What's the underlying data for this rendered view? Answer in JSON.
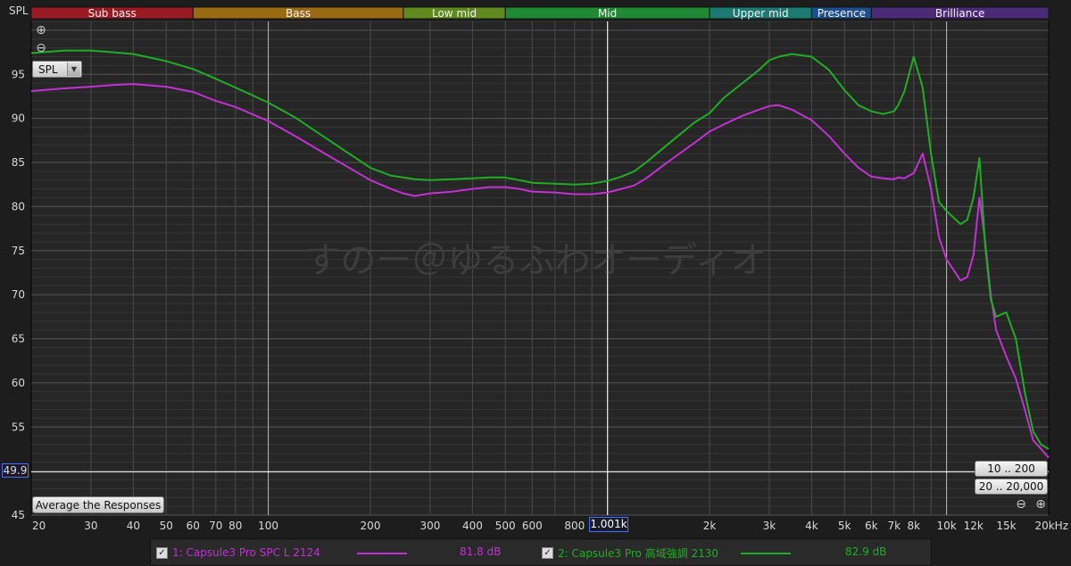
{
  "bands": [
    {
      "label": "Sub bass",
      "from": 20,
      "to": 60,
      "color": "#9b1b24"
    },
    {
      "label": "Bass",
      "from": 60,
      "to": 250,
      "color": "#9a6b12"
    },
    {
      "label": "Low mid",
      "from": 250,
      "to": 500,
      "color": "#5e8a1e"
    },
    {
      "label": "Mid",
      "from": 500,
      "to": 2000,
      "color": "#1f8a33"
    },
    {
      "label": "Upper mid",
      "from": 2000,
      "to": 4000,
      "color": "#1b7a72"
    },
    {
      "label": "Presence",
      "from": 4000,
      "to": 6000,
      "color": "#1f4e8c"
    },
    {
      "label": "Brilliance",
      "from": 6000,
      "to": 20000,
      "color": "#4b2a78"
    }
  ],
  "watermark": "すのー＠ゆるふわオーディオ",
  "controls": {
    "spl_select": "SPL",
    "average_button": "Average the Responses",
    "range_button_1": "10 .. 200",
    "range_button_2": "20 .. 20,000",
    "cursor_y_value": "49.9",
    "cursor_x_value": "1.001k",
    "zoom_in": "⊕",
    "zoom_out": "⊖",
    "dropdown_arrow": "▼"
  },
  "legend": {
    "items": [
      {
        "label": "1: Capsule3 Pro SPC L 2124",
        "value": "81.8 dB",
        "color": "#c42fd6",
        "checked": "✓"
      },
      {
        "label": "2: Capsule3 Pro 高域強調 2130",
        "value": "82.9 dB",
        "color": "#1fae23",
        "checked": "✓"
      }
    ]
  },
  "chart_data": {
    "type": "line",
    "xscale": "log",
    "xlim": [
      20,
      20000
    ],
    "ylim": [
      45,
      101
    ],
    "ylabel": "SPL",
    "grid": true,
    "x_ticks": [
      {
        "v": 20,
        "label": "20"
      },
      {
        "v": 30,
        "label": "30"
      },
      {
        "v": 40,
        "label": "40"
      },
      {
        "v": 50,
        "label": "50"
      },
      {
        "v": 60,
        "label": "60"
      },
      {
        "v": 70,
        "label": "70"
      },
      {
        "v": 80,
        "label": "80"
      },
      {
        "v": 100,
        "label": "100"
      },
      {
        "v": 200,
        "label": "200"
      },
      {
        "v": 300,
        "label": "300"
      },
      {
        "v": 400,
        "label": "400"
      },
      {
        "v": 500,
        "label": "500"
      },
      {
        "v": 600,
        "label": "600"
      },
      {
        "v": 800,
        "label": "800"
      },
      {
        "v": 2000,
        "label": "2k"
      },
      {
        "v": 3000,
        "label": "3k"
      },
      {
        "v": 4000,
        "label": "4k"
      },
      {
        "v": 5000,
        "label": "5k"
      },
      {
        "v": 6000,
        "label": "6k"
      },
      {
        "v": 7000,
        "label": "7k"
      },
      {
        "v": 8000,
        "label": "8k"
      },
      {
        "v": 10000,
        "label": "10k"
      },
      {
        "v": 12000,
        "label": "12k"
      },
      {
        "v": 15000,
        "label": "15k"
      },
      {
        "v": 20000,
        "label": "20kHz"
      }
    ],
    "y_ticks": [
      {
        "v": 45,
        "label": "45"
      },
      {
        "v": 50,
        "label": "50"
      },
      {
        "v": 55,
        "label": "55"
      },
      {
        "v": 60,
        "label": "60"
      },
      {
        "v": 65,
        "label": "65"
      },
      {
        "v": 70,
        "label": "70"
      },
      {
        "v": 75,
        "label": "75"
      },
      {
        "v": 80,
        "label": "80"
      },
      {
        "v": 85,
        "label": "85"
      },
      {
        "v": 90,
        "label": "90"
      },
      {
        "v": 95,
        "label": "95"
      }
    ],
    "cursor": {
      "x": 1001,
      "y": 49.9
    },
    "series": [
      {
        "name": "1: Capsule3 Pro SPC L 2124",
        "color": "#c42fd6",
        "x": [
          20,
          25,
          30,
          35,
          40,
          50,
          60,
          70,
          80,
          100,
          120,
          150,
          200,
          230,
          250,
          270,
          300,
          350,
          400,
          450,
          500,
          550,
          600,
          700,
          800,
          900,
          1000,
          1100,
          1200,
          1300,
          1500,
          1800,
          2000,
          2200,
          2500,
          2800,
          3000,
          3200,
          3500,
          4000,
          4500,
          5000,
          5500,
          6000,
          6500,
          7000,
          7200,
          7500,
          8000,
          8500,
          9000,
          9500,
          10000,
          11000,
          11500,
          12000,
          12500,
          13000,
          13500,
          14000,
          15000,
          16000,
          17000,
          18000,
          19000,
          20000
        ],
        "y": [
          93.1,
          93.4,
          93.6,
          93.8,
          93.9,
          93.6,
          93.0,
          92.0,
          91.3,
          89.7,
          88.0,
          85.8,
          83.0,
          82.0,
          81.5,
          81.2,
          81.5,
          81.7,
          82.0,
          82.2,
          82.2,
          82.0,
          81.7,
          81.6,
          81.4,
          81.4,
          81.6,
          82.0,
          82.4,
          83.2,
          85.0,
          87.2,
          88.5,
          89.3,
          90.3,
          91.0,
          91.4,
          91.5,
          91.0,
          89.8,
          88.0,
          86.0,
          84.4,
          83.4,
          83.2,
          83.1,
          83.3,
          83.2,
          83.8,
          86.0,
          82.0,
          76.5,
          74.0,
          71.6,
          72.0,
          74.5,
          81.0,
          76.0,
          70.0,
          66.0,
          63.0,
          60.5,
          57.0,
          53.5,
          52.5,
          51.5
        ]
      },
      {
        "name": "2: Capsule3 Pro 高域強調 2130",
        "color": "#1fae23",
        "x": [
          20,
          25,
          30,
          35,
          40,
          50,
          60,
          70,
          80,
          100,
          120,
          150,
          200,
          230,
          250,
          270,
          300,
          350,
          400,
          450,
          500,
          550,
          600,
          700,
          800,
          900,
          1000,
          1100,
          1200,
          1300,
          1500,
          1800,
          2000,
          2200,
          2500,
          2800,
          3000,
          3200,
          3500,
          4000,
          4500,
          5000,
          5500,
          6000,
          6500,
          7000,
          7200,
          7500,
          8000,
          8500,
          9000,
          9500,
          10000,
          11000,
          11500,
          12000,
          12500,
          13000,
          13500,
          14000,
          15000,
          16000,
          17000,
          18000,
          19000,
          20000
        ],
        "y": [
          97.4,
          97.7,
          97.7,
          97.5,
          97.3,
          96.5,
          95.6,
          94.5,
          93.5,
          91.8,
          90.1,
          87.6,
          84.4,
          83.5,
          83.3,
          83.1,
          83.0,
          83.1,
          83.2,
          83.3,
          83.3,
          83.0,
          82.7,
          82.6,
          82.5,
          82.6,
          82.9,
          83.4,
          84.0,
          85.0,
          87.0,
          89.5,
          90.6,
          92.3,
          94.0,
          95.5,
          96.6,
          97.0,
          97.3,
          97.0,
          95.5,
          93.2,
          91.5,
          90.8,
          90.5,
          90.8,
          91.5,
          93.0,
          97.0,
          93.5,
          86.0,
          80.5,
          79.5,
          78.0,
          78.5,
          81.0,
          85.5,
          75.5,
          69.5,
          67.5,
          68.0,
          65.0,
          59.0,
          54.5,
          53.0,
          52.5
        ]
      }
    ]
  }
}
